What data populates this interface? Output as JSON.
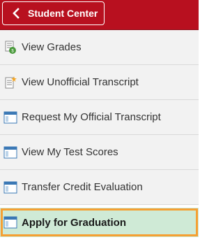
{
  "header": {
    "back_label": "Student Center"
  },
  "colors": {
    "header_bg": "#b8101f",
    "selected_bg": "#cfead6",
    "selected_outline": "#f5a033"
  },
  "menu": {
    "items": [
      {
        "label": "View Grades",
        "icon": "grades-icon"
      },
      {
        "label": "View Unofficial Transcript",
        "icon": "new-document-icon"
      },
      {
        "label": "Request My Official Transcript",
        "icon": "window-icon"
      },
      {
        "label": "View My Test Scores",
        "icon": "window-icon"
      },
      {
        "label": "Transfer Credit Evaluation",
        "icon": "window-icon"
      },
      {
        "label": "Apply for Graduation",
        "icon": "window-icon",
        "selected": true
      }
    ]
  }
}
